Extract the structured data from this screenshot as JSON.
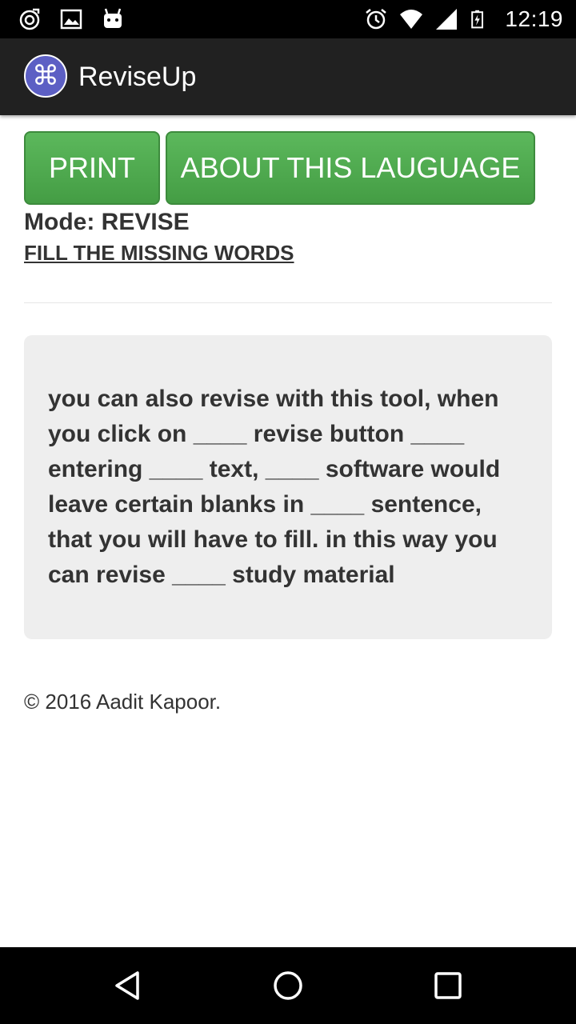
{
  "status_bar": {
    "time": "12:19",
    "left_icons": [
      "music-sync-icon",
      "image-icon",
      "android-icon"
    ],
    "right_icons": [
      "alarm-icon",
      "wifi-icon",
      "signal-icon",
      "battery-charging-icon"
    ]
  },
  "app_bar": {
    "title": "ReviseUp",
    "logo_glyph": "⌘",
    "logo_icon": "command-logo-icon"
  },
  "buttons": {
    "print_label": "PRINT",
    "about_label": "ABOUT THIS LAUGUAGE"
  },
  "mode": {
    "text": "Mode: REVISE"
  },
  "instruction": "FILL THE MISSING WORDS",
  "revision_text": "you can also revise with this tool, when you click on ____ revise button ____ entering ____ text, ____ software would leave certain blanks in ____ sentence, that you will have to fill. in this way you can revise ____ study material",
  "footer": "© 2016 Aadit Kapoor.",
  "navigation": {
    "back_icon": "back-triangle-icon",
    "home_icon": "home-circle-icon",
    "recent_icon": "recent-apps-square-icon"
  },
  "colors": {
    "button_green": "#5cb85c",
    "app_bar_bg": "#212121",
    "logo_purple": "#5c5fc4",
    "well_bg": "#eeeeee"
  }
}
